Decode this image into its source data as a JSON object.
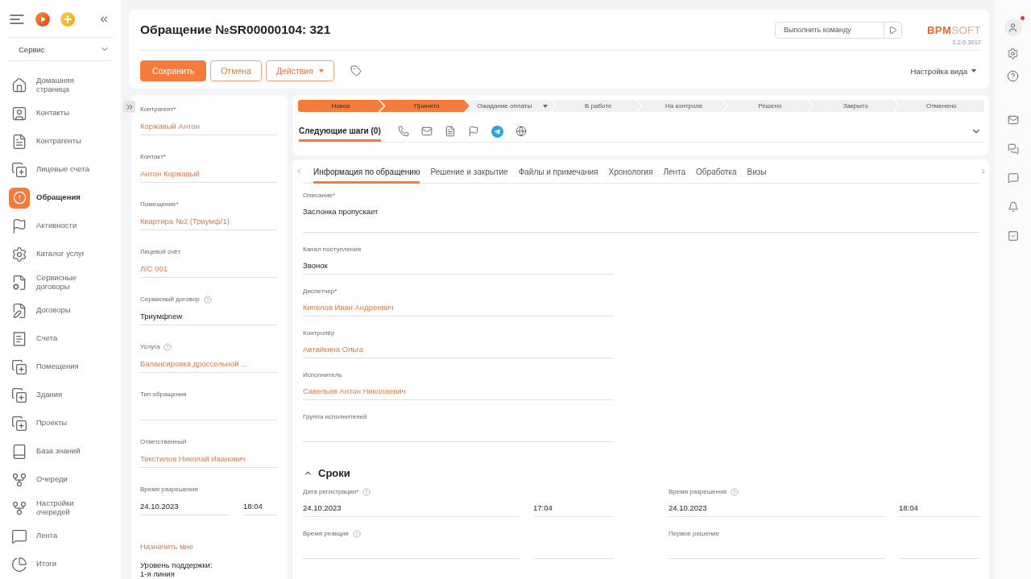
{
  "sidebar": {
    "section_select": {
      "value": "Сервис"
    },
    "items": [
      {
        "label": "Домашняя\nстраница",
        "selected": false
      },
      {
        "label": "Контакты",
        "selected": false
      },
      {
        "label": "Контрагенты",
        "selected": false
      },
      {
        "label": "Лицевые счета",
        "selected": false
      },
      {
        "label": "Обращения",
        "selected": true
      },
      {
        "label": "Активности",
        "selected": false
      },
      {
        "label": "Каталог услуг",
        "selected": false
      },
      {
        "label": "Сервисные\nдоговоры",
        "selected": false
      },
      {
        "label": "Договоры",
        "selected": false
      },
      {
        "label": "Счета",
        "selected": false
      },
      {
        "label": "Помещения",
        "selected": false
      },
      {
        "label": "Здания",
        "selected": false
      },
      {
        "label": "Проекты",
        "selected": false
      },
      {
        "label": "База знаний",
        "selected": false
      },
      {
        "label": "Очереди",
        "selected": false
      },
      {
        "label": "Настройки\nочередей",
        "selected": false
      },
      {
        "label": "Лента",
        "selected": false
      },
      {
        "label": "Итоги",
        "selected": false
      }
    ]
  },
  "header": {
    "title": "Обращение №SR00000104: 321",
    "command_field": {
      "placeholder": "Выполнить команду"
    },
    "logo": "**BPM**SOFT",
    "version": "1.2.0.3012",
    "buttons": [
      {
        "label": "Сохранить",
        "kind": "primary"
      },
      {
        "label": "Отмена",
        "kind": "secondary"
      },
      {
        "label": "Действия",
        "kind": "menu"
      }
    ],
    "view_settings": "Настройка вида"
  },
  "left_panel": {
    "fields": [
      {
        "label": "Контрагент*",
        "help": false,
        "kind": "lookup",
        "value": "Коржавый Антон"
      },
      {
        "label": "Контакт*",
        "help": false,
        "kind": "lookup",
        "value": "Антон Коржавый"
      },
      {
        "label": "Помещение*",
        "help": false,
        "kind": "lookup",
        "value": "Квартира №2 (Триумф/1)"
      },
      {
        "label": "Лицевой счёт",
        "help": false,
        "kind": "lookup",
        "value": "Л/С 001"
      },
      {
        "label": "Сервисный договор",
        "help": true,
        "kind": "text",
        "value": "Триумфnew"
      },
      {
        "label": "Услуга",
        "help": true,
        "kind": "lookup",
        "value": "Балансировка дроссельной ..."
      },
      {
        "label": "Тип обращения",
        "help": false,
        "kind": "lookup"
      },
      {
        "label": "Ответственный",
        "help": false,
        "kind": "lookup",
        "value": "Текстилов Николай Иванович"
      },
      {
        "label": "Время разрешения",
        "help": false,
        "kind": "datetime",
        "date": "24.10.2023",
        "time": "18:04"
      }
    ],
    "assign_link": "Назначить мне",
    "support_level": "Уровень поддержки:\n1-я линия"
  },
  "stages": [
    {
      "label": "Новое",
      "done": true,
      "has_menu": false
    },
    {
      "label": "Принято",
      "done": true,
      "has_menu": false
    },
    {
      "label": "Ожидание оплаты",
      "done": false,
      "has_menu": true
    },
    {
      "label": "В работе",
      "done": false,
      "has_menu": false
    },
    {
      "label": "На контроле",
      "done": false,
      "has_menu": false
    },
    {
      "label": "Решено",
      "done": false,
      "has_menu": false
    },
    {
      "label": "Закрыто",
      "done": false,
      "has_menu": false
    },
    {
      "label": "Отменено",
      "done": false,
      "has_menu": false
    }
  ],
  "next_steps": {
    "label": "Следующие шаги (0)",
    "selected": true
  },
  "tabs": [
    {
      "label": "Информация по обращению",
      "selected": true
    },
    {
      "label": "Решение и закрытие",
      "selected": false
    },
    {
      "label": "Файлы и примечания",
      "selected": false
    },
    {
      "label": "Хронология",
      "selected": false
    },
    {
      "label": "Лента",
      "selected": false
    },
    {
      "label": "Обработка",
      "selected": false
    },
    {
      "label": "Визы",
      "selected": false
    }
  ],
  "main_fields": [
    {
      "label": "Описание*",
      "help": false,
      "kind": "textarea",
      "value": "Заслонка пропускает"
    },
    {
      "label": "Канал поступления",
      "help": false,
      "kind": "text",
      "value": "Звонок"
    },
    {
      "label": "Диспетчер*",
      "help": false,
      "kind": "lookup",
      "value": "Кипелов Иван Андреевич"
    },
    {
      "label": "Контролёр",
      "help": false,
      "kind": "lookup",
      "value": "Автайкина Ольга"
    },
    {
      "label": "Исполнитель",
      "help": false,
      "kind": "lookup",
      "value": "Савельев Антон Николаевич"
    },
    {
      "label": "Группа исполнителей",
      "help": false,
      "kind": "lookup"
    }
  ],
  "deadlines": {
    "title": "Сроки",
    "expanded": true,
    "fields": [
      {
        "label": "Дата регистрации*",
        "help": true,
        "date": "24.10.2023",
        "time": "17:04"
      },
      {
        "label": "Время разрешения",
        "help": true,
        "date": "24.10.2023",
        "time": "18:04"
      },
      {
        "label": "Время реакции",
        "help": true
      },
      {
        "label": "Первое решение",
        "help": false
      }
    ]
  },
  "right_bar": {
    "notification": true
  }
}
